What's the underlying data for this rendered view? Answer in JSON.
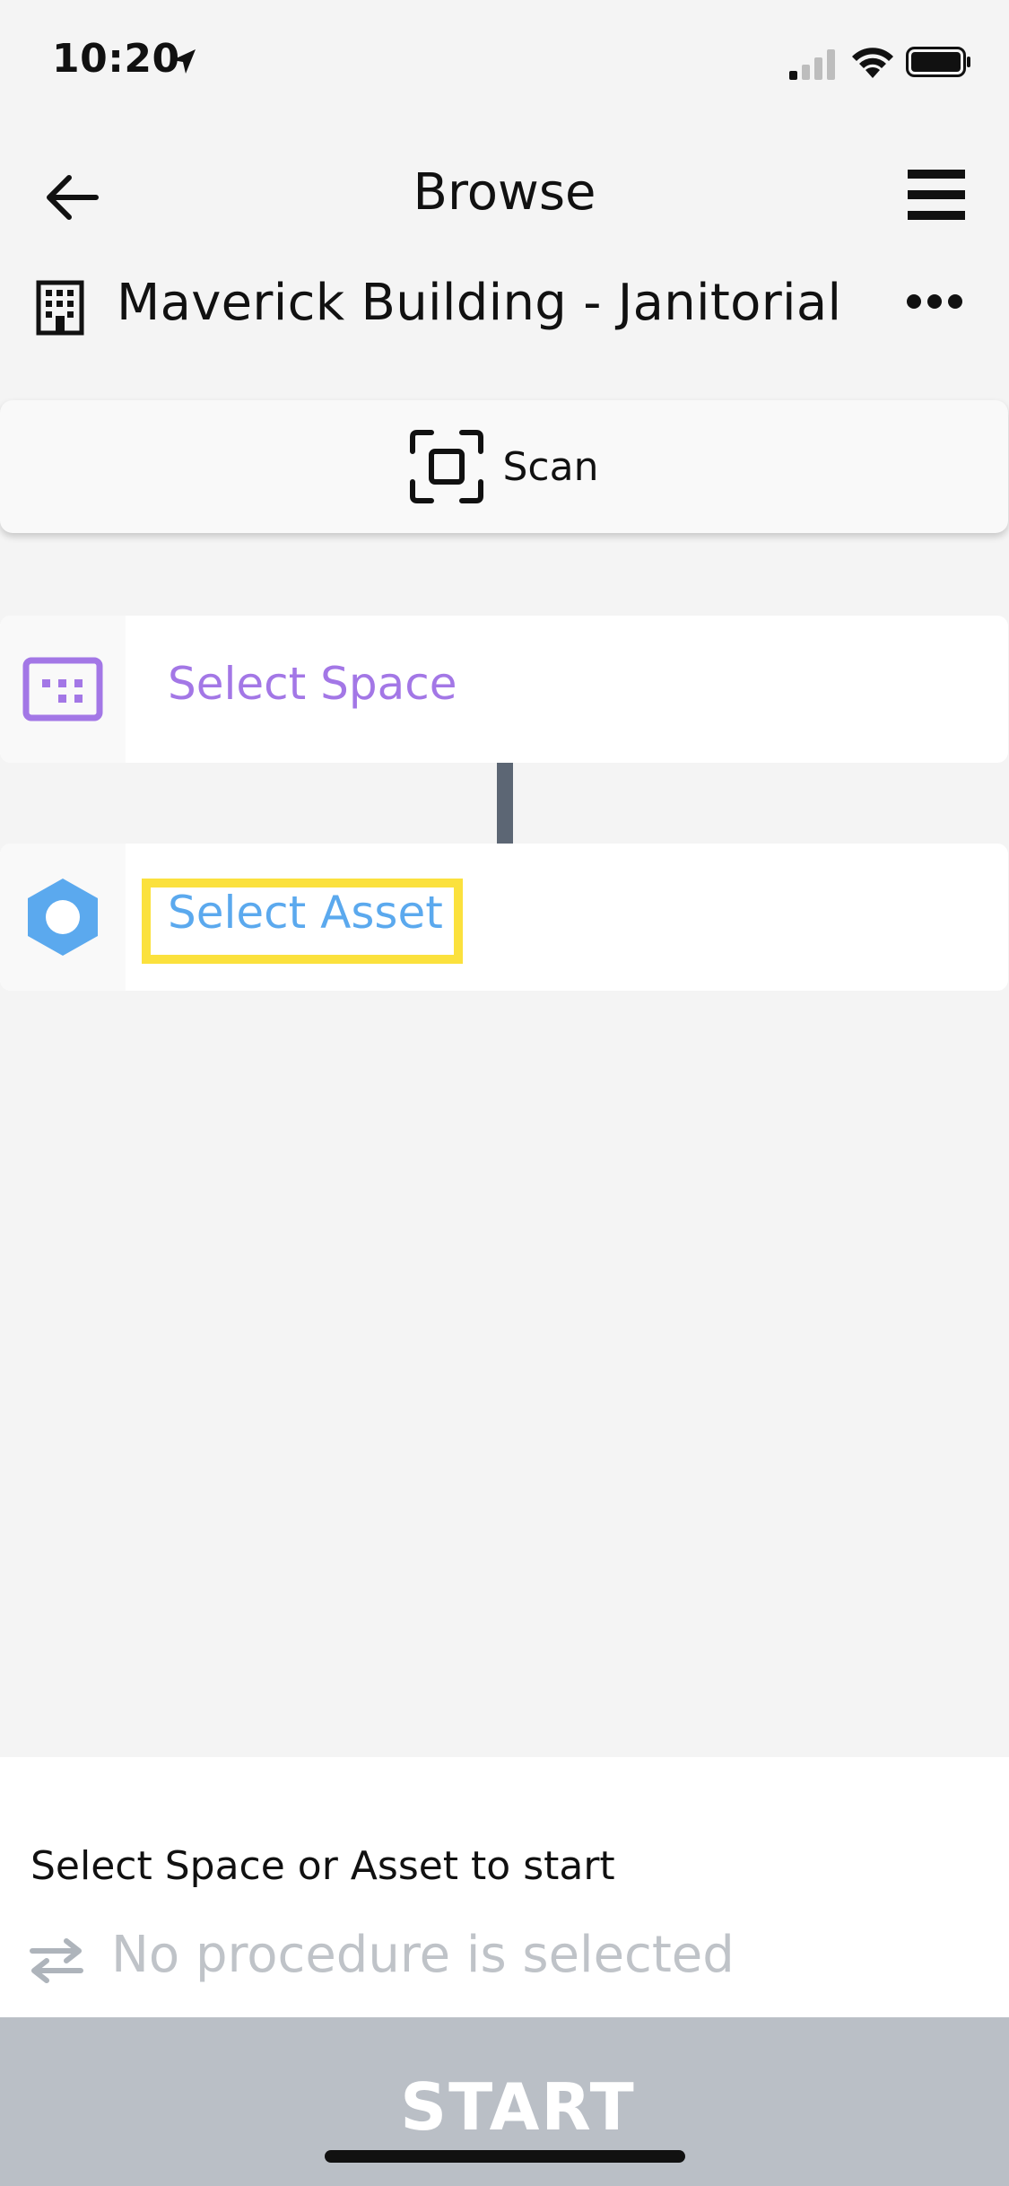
{
  "status_bar": {
    "time": "10:20",
    "icons": [
      "location-arrow-icon",
      "signal-icon",
      "wifi-icon",
      "battery-icon"
    ]
  },
  "header": {
    "title": "Browse",
    "back_icon": "back-arrow-icon",
    "menu_icon": "hamburger-menu-icon"
  },
  "building": {
    "name": "Maverick Building - Janitorial",
    "icon": "building-icon",
    "more_icon": "more-dots-icon"
  },
  "scan": {
    "label": "Scan",
    "icon": "scan-frame-icon"
  },
  "selections": {
    "space": {
      "label": "Select Space",
      "icon": "space-icon",
      "color": "#a377e6"
    },
    "asset": {
      "label": "Select Asset",
      "icon": "asset-hexagon-icon",
      "color": "#5ba9ee",
      "highlight_color": "#fbe13d"
    }
  },
  "footer": {
    "hint": "Select Space or Asset to start",
    "procedure_status": "No procedure is selected",
    "procedure_icon": "swap-arrows-icon",
    "start_label": "START",
    "start_bg": "#babfc6"
  }
}
